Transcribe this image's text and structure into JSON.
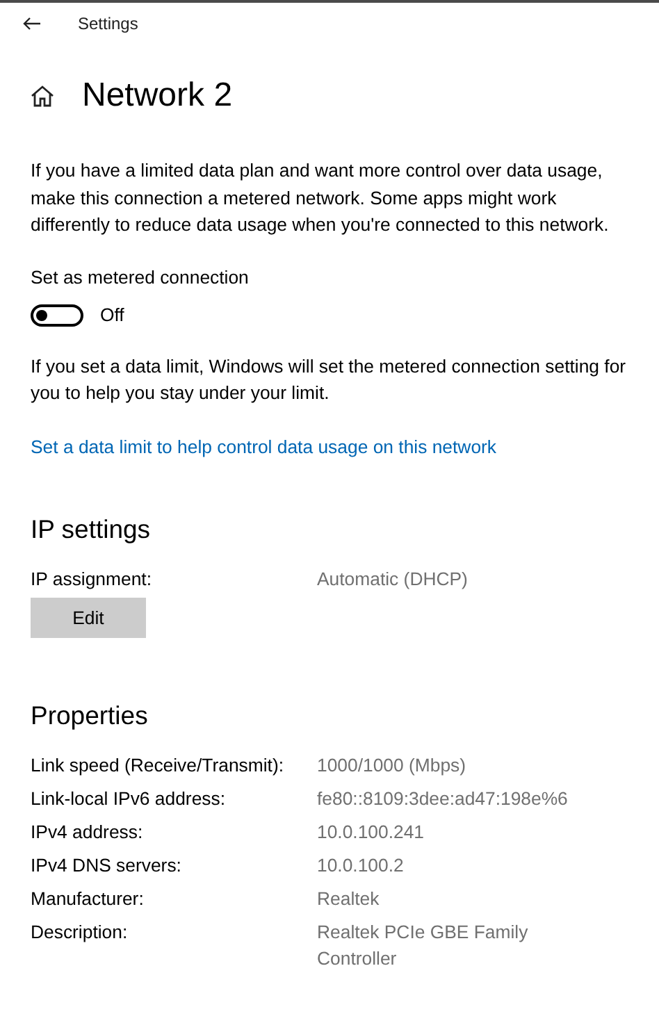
{
  "header": {
    "title": "Settings"
  },
  "page_title": "Network 2",
  "metered": {
    "description": "If you have a limited data plan and want more control over data usage, make this connection a metered network. Some apps might work differently to reduce data usage when you're connected to this network.",
    "toggle_label": "Set as metered connection",
    "on": false,
    "state_text": "Off",
    "limit_note": "If you set a data limit, Windows will set the metered connection setting for you to help you stay under your limit.",
    "link": "Set a data limit to help control data usage on this network"
  },
  "ip_settings": {
    "heading": "IP settings",
    "label": "IP assignment:",
    "value": "Automatic (DHCP)",
    "button": "Edit"
  },
  "properties": {
    "heading": "Properties",
    "rows": [
      {
        "label": "Link speed (Receive/Transmit):",
        "value": "1000/1000 (Mbps)"
      },
      {
        "label": "Link-local IPv6 address:",
        "value": "fe80::8109:3dee:ad47:198e%6"
      },
      {
        "label": "IPv4 address:",
        "value": "10.0.100.241"
      },
      {
        "label": "IPv4 DNS servers:",
        "value": "10.0.100.2"
      },
      {
        "label": "Manufacturer:",
        "value": "Realtek"
      },
      {
        "label": "Description:",
        "value": "Realtek PCIe GBE Family Controller"
      }
    ]
  }
}
